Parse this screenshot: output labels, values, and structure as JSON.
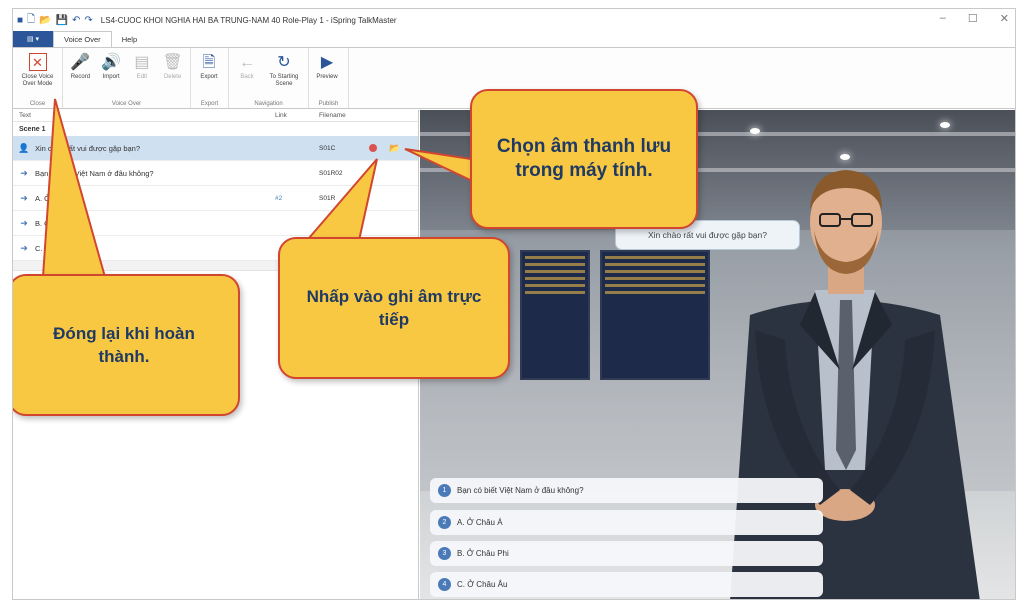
{
  "window": {
    "title": "LS4-CUOC KHOI NGHIA HAI BA TRUNG-NAM 40 Role-Play 1 - iSpring TalkMaster",
    "min": "–",
    "max": "☐",
    "close": "✕"
  },
  "tabs": {
    "file": "▤ ▾",
    "voice_over": "Voice Over",
    "help": "Help"
  },
  "ribbon": {
    "close_voice_over_mode": "Close Voice Over Mode",
    "group_close": "Close",
    "record": "Record",
    "import": "Import",
    "edit": "Edit",
    "delete": "Delete",
    "group_voice_over": "Voice Over",
    "export": "Export",
    "group_export": "Export",
    "back": "Back",
    "to_starting_scene": "To Starting Scene",
    "group_navigation": "Navigation",
    "preview": "Preview",
    "group_publish": "Publish"
  },
  "table": {
    "col_text": "Text",
    "col_link": "Link",
    "col_filename": "Filename",
    "scene_label": "Scene 1",
    "rows": [
      {
        "text": "Xin chào rất vui được gặp bạn?",
        "link": "",
        "filename": "S01C"
      },
      {
        "text": "Bạn có biết Việt Nam ở đâu không?",
        "link": "",
        "filename": "S01R02"
      },
      {
        "text": "A. Ở Châu Á",
        "link": "#2",
        "filename": "S01R"
      },
      {
        "text": "B. Ở Châu Phi",
        "link": "",
        "filename": ""
      },
      {
        "text": "C. Ở Châu Âu",
        "link": "",
        "filename": ""
      }
    ]
  },
  "scene": {
    "speech": "Xin chào rất vui được gặp bạn?",
    "options": [
      {
        "num": "1",
        "text": "Bạn có biết Việt Nam ở đâu không?"
      },
      {
        "num": "2",
        "text": "A. Ở Châu Á"
      },
      {
        "num": "3",
        "text": "B. Ở Châu Phi"
      },
      {
        "num": "4",
        "text": "C. Ở Châu Âu"
      }
    ]
  },
  "callouts": {
    "import_hint": "Chọn âm thanh lưu trong máy tính.",
    "record_hint": "Nhấp vào ghi âm trực tiếp",
    "close_hint": "Đóng lại khi hoàn thành."
  },
  "colors": {
    "accent": "#2b579a",
    "callout_fill": "#f9c843",
    "callout_border": "#d1462f",
    "callout_text": "#1f3a63"
  }
}
